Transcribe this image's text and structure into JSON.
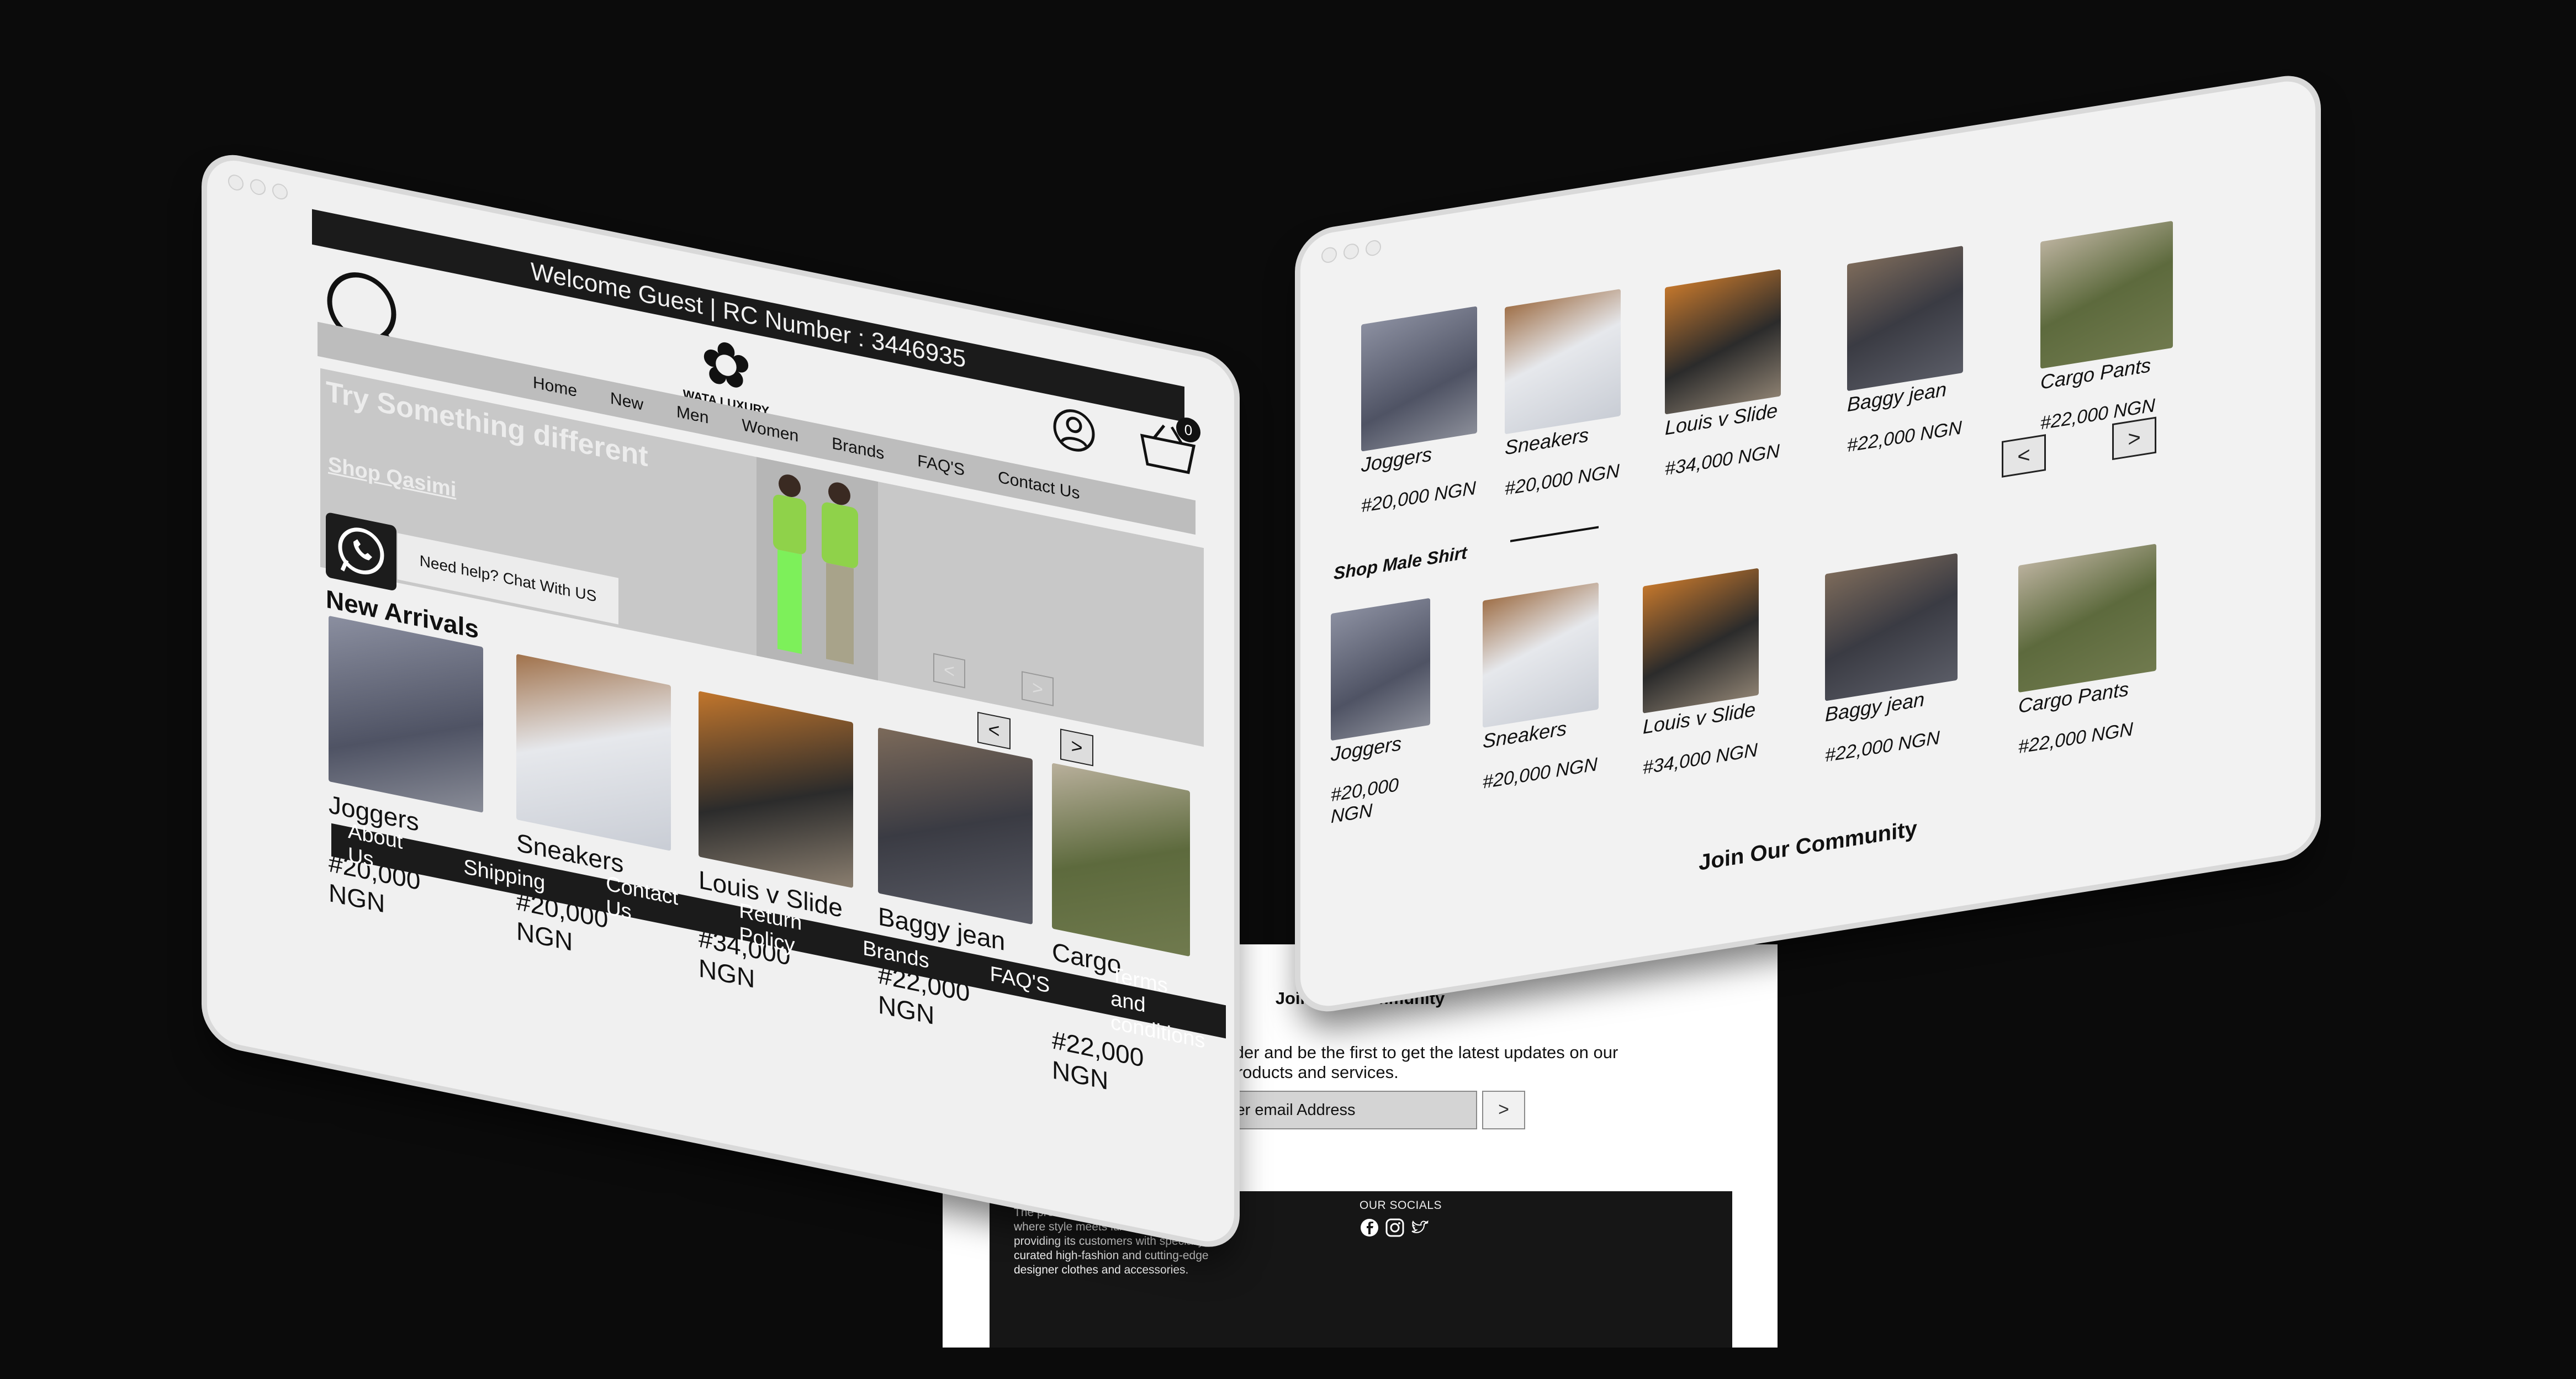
{
  "brand": {
    "name": "WATA LUXURY"
  },
  "left_tablet": {
    "welcome": "Welcome Guest | RC Number : 3446935",
    "cart_count": "0",
    "nav": [
      "Home",
      "New",
      "Men",
      "Women",
      "Brands",
      "FAQ'S",
      "Contact Us"
    ],
    "hero": {
      "headline": "Try Something different",
      "cta": "Shop Qasimi",
      "prev": "<",
      "next": ">"
    },
    "whatsapp": {
      "label": "Need help? Chat With US"
    },
    "new_arrivals": {
      "title": "New Arrivals",
      "prev": "<",
      "next": ">"
    },
    "products": [
      {
        "name": "Joggers",
        "price": "#20,000 NGN",
        "image": "joggers"
      },
      {
        "name": "Sneakers",
        "price": "#20,000 NGN",
        "image": "sneakers"
      },
      {
        "name": "Louis v Slide",
        "price": "#34,000 NGN",
        "image": "slides"
      },
      {
        "name": "Baggy jean",
        "price": "#22,000 NGN",
        "image": "jeans"
      },
      {
        "name": "Cargo Pants",
        "price": "#22,000 NGN",
        "image": "cargo"
      }
    ],
    "footer_links": [
      "About Us",
      "Shipping",
      "Contact Us",
      "Return Policy",
      "Brands",
      "FAQ'S",
      "Terms and conditions"
    ]
  },
  "right_tablet": {
    "top_products": [
      {
        "name": "Joggers",
        "price": "#20,000 NGN"
      },
      {
        "name": "Sneakers",
        "price": "#20,000 NGN"
      },
      {
        "name": "Louis v Slide",
        "price": "#34,000 NGN"
      },
      {
        "name": "Baggy jean",
        "price": "#22,000 NGN"
      },
      {
        "name": "Cargo Pants",
        "price": "#22,000 NGN"
      }
    ],
    "section_title": "Shop Male Shirt",
    "prev": "<",
    "next": ">",
    "bottom_products": [
      {
        "name": "Joggers",
        "price": "#20,000 NGN"
      },
      {
        "name": "Sneakers",
        "price": "#20,000 NGN"
      },
      {
        "name": "Louis v Slide",
        "price": "#34,000 NGN"
      },
      {
        "name": "Baggy jean",
        "price": "#22,000 NGN"
      },
      {
        "name": "Cargo Pants",
        "price": "#22,000 NGN"
      }
    ],
    "community_title": "Join Our Community"
  },
  "newsletter": {
    "title": "Join Our Community",
    "text": "Get 10% off your first order and be the first to get the latest updates on our promotion campaigns, products and services.",
    "email_placeholder": "Enter email Address",
    "submit": ">"
  },
  "footer": {
    "about": "The premier e-commerce destination where style meets luxury, renowned for providing its customers with specially curated high-fashion and cutting-edge designer clothes and accessories.",
    "socials_title": "OUR SOCIALS",
    "socials": [
      "facebook-icon",
      "instagram-icon",
      "twitter-icon"
    ]
  }
}
